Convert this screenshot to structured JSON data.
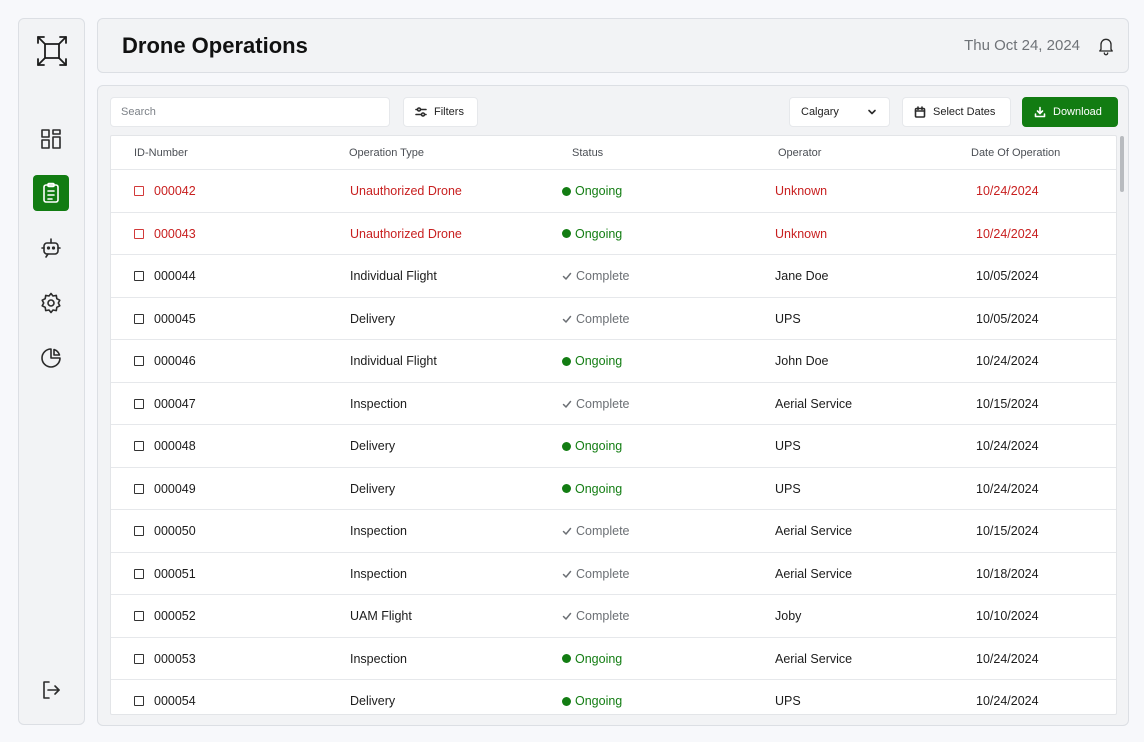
{
  "sidebar": {
    "logo_icon": "drone-frame-icon",
    "items": [
      {
        "name": "dashboard",
        "icon": "grid-icon",
        "active": false
      },
      {
        "name": "operations",
        "icon": "clipboard-icon",
        "active": true
      },
      {
        "name": "bots",
        "icon": "bot-icon",
        "active": false
      },
      {
        "name": "settings",
        "icon": "gear-icon",
        "active": false
      },
      {
        "name": "reports",
        "icon": "pie-chart-icon",
        "active": false
      }
    ],
    "logout_icon": "logout-icon"
  },
  "header": {
    "title": "Drone Operations",
    "date": "Thu Oct 24, 2024",
    "notification_icon": "bell-icon"
  },
  "toolbar": {
    "search_placeholder": "Search",
    "filters_label": "Filters",
    "city_label": "Calgary",
    "dates_label": "Select Dates",
    "download_label": "Download"
  },
  "colors": {
    "accent": "#127c12",
    "alert": "#c81f1f",
    "ongoing": "#137d13",
    "complete": "#6c7075"
  },
  "table": {
    "columns": [
      "ID-Number",
      "Operation Type",
      "Status",
      "Operator",
      "Date Of Operation"
    ],
    "rows": [
      {
        "id": "000042",
        "type": "Unauthorized Drone",
        "status": "Ongoing",
        "operator": "Unknown",
        "date": "10/24/2024",
        "alert": true
      },
      {
        "id": "000043",
        "type": "Unauthorized Drone",
        "status": "Ongoing",
        "operator": "Unknown",
        "date": "10/24/2024",
        "alert": true
      },
      {
        "id": "000044",
        "type": "Individual Flight",
        "status": "Complete",
        "operator": "Jane Doe",
        "date": "10/05/2024",
        "alert": false
      },
      {
        "id": "000045",
        "type": "Delivery",
        "status": "Complete",
        "operator": "UPS",
        "date": "10/05/2024",
        "alert": false
      },
      {
        "id": "000046",
        "type": "Individual Flight",
        "status": "Ongoing",
        "operator": "John Doe",
        "date": "10/24/2024",
        "alert": false
      },
      {
        "id": "000047",
        "type": "Inspection",
        "status": "Complete",
        "operator": "Aerial Service",
        "date": "10/15/2024",
        "alert": false
      },
      {
        "id": "000048",
        "type": "Delivery",
        "status": "Ongoing",
        "operator": "UPS",
        "date": "10/24/2024",
        "alert": false
      },
      {
        "id": "000049",
        "type": "Delivery",
        "status": "Ongoing",
        "operator": "UPS",
        "date": "10/24/2024",
        "alert": false
      },
      {
        "id": "000050",
        "type": "Inspection",
        "status": "Complete",
        "operator": "Aerial Service",
        "date": "10/15/2024",
        "alert": false
      },
      {
        "id": "000051",
        "type": "Inspection",
        "status": "Complete",
        "operator": "Aerial Service",
        "date": "10/18/2024",
        "alert": false
      },
      {
        "id": "000052",
        "type": "UAM Flight",
        "status": "Complete",
        "operator": "Joby",
        "date": "10/10/2024",
        "alert": false
      },
      {
        "id": "000053",
        "type": "Inspection",
        "status": "Ongoing",
        "operator": "Aerial Service",
        "date": "10/24/2024",
        "alert": false
      },
      {
        "id": "000054",
        "type": "Delivery",
        "status": "Ongoing",
        "operator": "UPS",
        "date": "10/24/2024",
        "alert": false
      }
    ]
  }
}
